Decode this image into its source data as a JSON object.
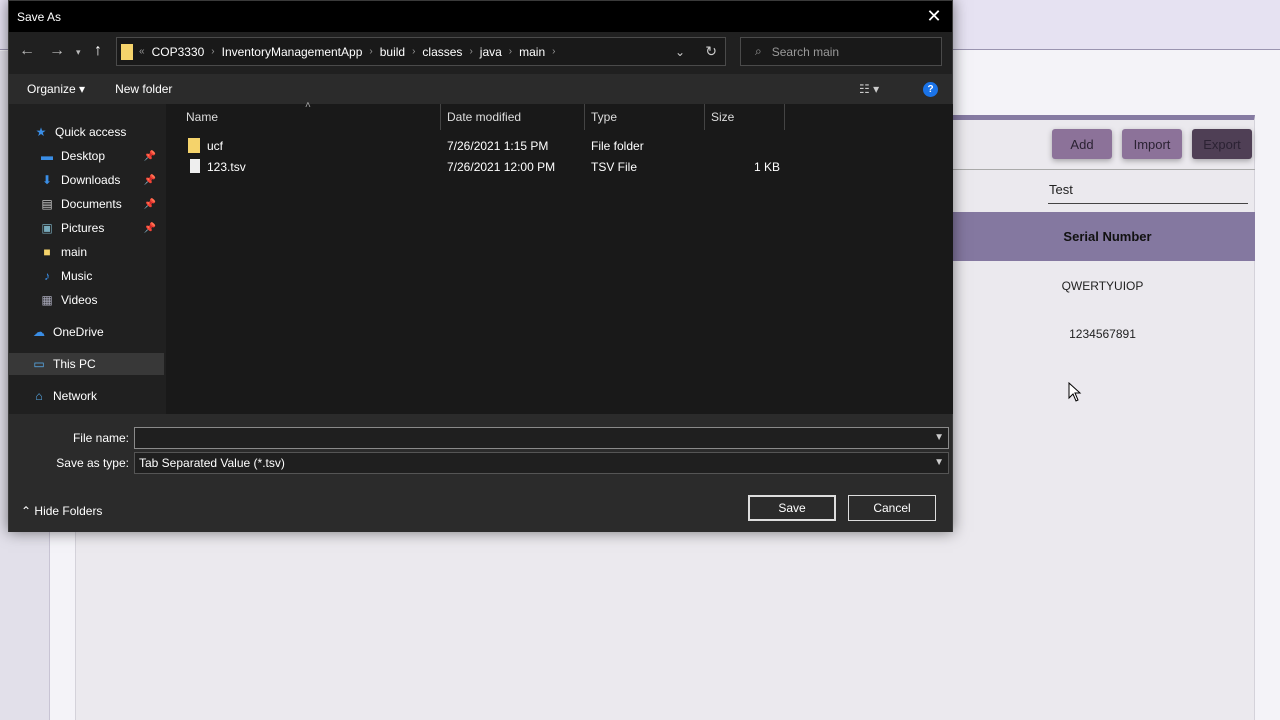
{
  "app": {
    "buttons": {
      "add": "Add",
      "import": "Import",
      "export": "Export"
    },
    "search_value": "Test",
    "column_header": "Serial Number",
    "rows": [
      "QWERTYUIOP",
      "1234567891"
    ],
    "colors": {
      "accent": "#857aa2",
      "add_button": "#8c7299",
      "export_button": "#4f3f55"
    }
  },
  "dialog": {
    "title": "Save As",
    "breadcrumb": [
      "COP3330",
      "InventoryManagementApp",
      "build",
      "classes",
      "java",
      "main"
    ],
    "search_placeholder": "Search main",
    "organize": "Organize",
    "new_folder": "New folder",
    "nav": [
      {
        "label": "Quick access",
        "icon": "star-icon",
        "pinned": false
      },
      {
        "label": "Desktop",
        "icon": "desktop-icon",
        "pinned": true
      },
      {
        "label": "Downloads",
        "icon": "download-icon",
        "pinned": true
      },
      {
        "label": "Documents",
        "icon": "document-icon",
        "pinned": true
      },
      {
        "label": "Pictures",
        "icon": "pictures-icon",
        "pinned": true
      },
      {
        "label": "main",
        "icon": "folder-icon",
        "pinned": false
      },
      {
        "label": "Music",
        "icon": "music-icon",
        "pinned": false
      },
      {
        "label": "Videos",
        "icon": "video-icon",
        "pinned": false
      },
      {
        "label": "OneDrive",
        "icon": "cloud-icon",
        "pinned": false
      },
      {
        "label": "This PC",
        "icon": "computer-icon",
        "pinned": false
      },
      {
        "label": "Network",
        "icon": "network-icon",
        "pinned": false
      }
    ],
    "columns": {
      "name": "Name",
      "date": "Date modified",
      "type": "Type",
      "size": "Size"
    },
    "files": [
      {
        "name": "ucf",
        "date": "7/26/2021 1:15 PM",
        "type": "File folder",
        "size": "",
        "icon": "folder-icon"
      },
      {
        "name": "123.tsv",
        "date": "7/26/2021 12:00 PM",
        "type": "TSV File",
        "size": "1 KB",
        "icon": "file-icon"
      }
    ],
    "file_name_label": "File name:",
    "file_name_value": "",
    "save_type_label": "Save as type:",
    "save_type_value": "Tab Separated Value (*.tsv)",
    "hide_folders": "Hide Folders",
    "save": "Save",
    "cancel": "Cancel"
  }
}
